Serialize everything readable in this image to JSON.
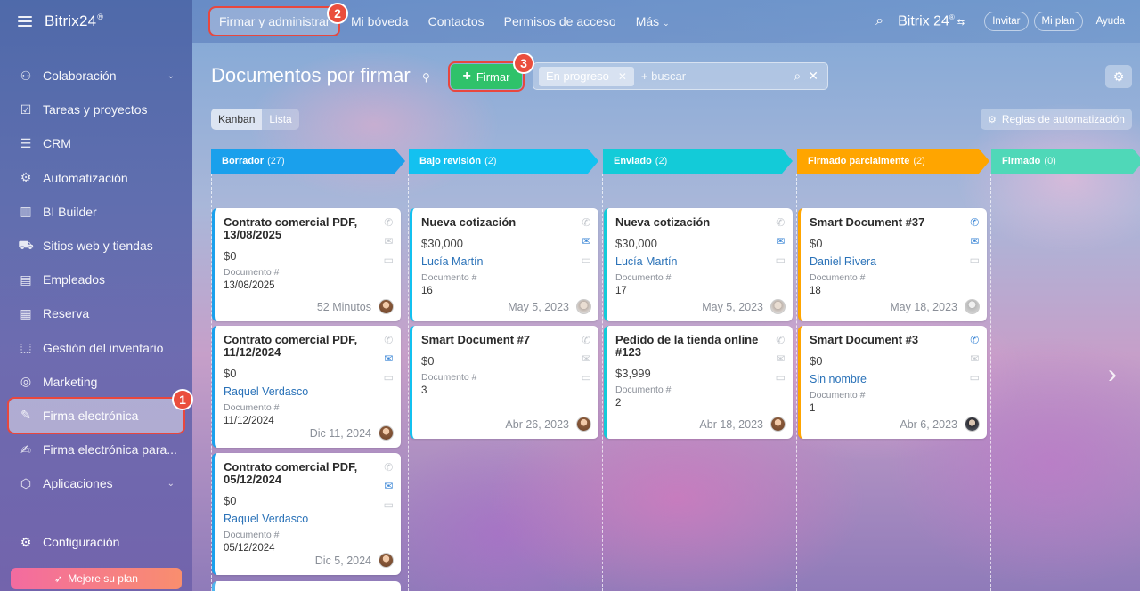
{
  "sidebar": {
    "brand": "Bitrix24",
    "brand_mark": "®",
    "items": [
      {
        "label": "Colaboración",
        "icon": "collaboration-icon",
        "glyph": "⚇",
        "chevron": true
      },
      {
        "label": "Tareas y proyectos",
        "icon": "tasks-icon",
        "glyph": "☑",
        "chevron": false
      },
      {
        "label": "CRM",
        "icon": "crm-icon",
        "glyph": "☰",
        "chevron": false
      },
      {
        "label": "Automatización",
        "icon": "automation-icon",
        "glyph": "⚙",
        "chevron": false
      },
      {
        "label": "BI Builder",
        "icon": "bi-builder-icon",
        "glyph": "▥",
        "chevron": false
      },
      {
        "label": "Sitios web y tiendas",
        "icon": "cart-icon",
        "glyph": "⛟",
        "chevron": false
      },
      {
        "label": "Empleados",
        "icon": "employees-icon",
        "glyph": "▤",
        "chevron": false
      },
      {
        "label": "Reserva",
        "icon": "calendar-icon",
        "glyph": "▦",
        "chevron": false
      },
      {
        "label": "Gestión del inventario",
        "icon": "inventory-icon",
        "glyph": "⬚",
        "chevron": false
      },
      {
        "label": "Marketing",
        "icon": "marketing-icon",
        "glyph": "◎",
        "chevron": false
      },
      {
        "label": "Firma electrónica",
        "icon": "signature-icon",
        "glyph": "✎",
        "chevron": false,
        "active": true
      },
      {
        "label": "Firma electrónica para...",
        "icon": "document-signature-icon",
        "glyph": "✍",
        "chevron": false
      },
      {
        "label": "Aplicaciones",
        "icon": "apps-icon",
        "glyph": "⬡",
        "chevron": true
      }
    ],
    "config_label": "Configuración",
    "upgrade_label": "Mejore su plan"
  },
  "topbar": {
    "tabs": [
      {
        "label": "Firmar y administrar",
        "active": true
      },
      {
        "label": "Mi bóveda"
      },
      {
        "label": "Contactos"
      },
      {
        "label": "Permisos de acceso"
      },
      {
        "label": "Más",
        "chevron": true
      }
    ],
    "brand": "Bitrix 24",
    "brand_mark": "®",
    "buttons": {
      "invite": "Invitar",
      "plan": "Mi plan",
      "help": "Ayuda"
    }
  },
  "badges": {
    "b1": "1",
    "b2": "2",
    "b3": "3"
  },
  "header": {
    "title": "Documentos por firmar",
    "sign_button": "Firmar",
    "filter_chip": "En progreso",
    "search_placeholder": "+ buscar",
    "view_kanban": "Kanban",
    "view_list": "Lista",
    "automation_rules": "Reglas de automatización"
  },
  "columns": [
    {
      "name": "Borrador",
      "count": "(27)",
      "color": "#1aa0ec"
    },
    {
      "name": "Bajo revisión",
      "count": "(2)",
      "color": "#13c1f0"
    },
    {
      "name": "Enviado",
      "count": "(2)",
      "color": "#13cbd8"
    },
    {
      "name": "Firmado parcialmente",
      "count": "(2)",
      "color": "#ffa500"
    },
    {
      "name": "Firmado",
      "count": "(0)",
      "color": "#4fd8b8"
    }
  ],
  "cards": [
    {
      "col": 0,
      "title": "Contrato comercial PDF, 13/08/2025",
      "amount": "$0",
      "person": "",
      "doc_label": "Documento #",
      "doc_value": "13/08/2025",
      "date": "52 Minutos",
      "avatar": "",
      "mail_on": false,
      "phone_on": false
    },
    {
      "col": 0,
      "title": "Contrato comercial PDF, 11/12/2024",
      "amount": "$0",
      "person": "Raquel Verdasco",
      "doc_label": "Documento #",
      "doc_value": "11/12/2024",
      "date": "Dic 11, 2024",
      "avatar": "",
      "mail_on": true,
      "phone_on": false
    },
    {
      "col": 0,
      "title": "Contrato comercial PDF, 05/12/2024",
      "amount": "$0",
      "person": "Raquel Verdasco",
      "doc_label": "Documento #",
      "doc_value": "05/12/2024",
      "date": "Dic 5, 2024",
      "avatar": "",
      "mail_on": true,
      "phone_on": false
    },
    {
      "col": 1,
      "title": "Nueva cotización",
      "amount": "$30,000",
      "person": "Lucía Martín",
      "doc_label": "Documento #",
      "doc_value": "16",
      "date": "May 5, 2023",
      "avatar": "light",
      "mail_on": true,
      "phone_on": false
    },
    {
      "col": 1,
      "title": "Smart Document #7",
      "amount": "$0",
      "person": "",
      "doc_label": "Documento #",
      "doc_value": "3",
      "date": "Abr 26, 2023",
      "avatar": "",
      "mail_on": false,
      "phone_on": false
    },
    {
      "col": 2,
      "title": "Nueva cotización",
      "amount": "$30,000",
      "person": "Lucía Martín",
      "doc_label": "Documento #",
      "doc_value": "17",
      "date": "May 5, 2023",
      "avatar": "light",
      "mail_on": true,
      "phone_on": false
    },
    {
      "col": 2,
      "title": "Pedido de la tienda online #123",
      "amount": "$3,999",
      "person": "",
      "doc_label": "Documento #",
      "doc_value": "2",
      "date": "Abr 18, 2023",
      "avatar": "",
      "mail_on": false,
      "phone_on": false
    },
    {
      "col": 3,
      "title": "Smart Document #37",
      "amount": "$0",
      "person": "Daniel Rivera",
      "doc_label": "Documento #",
      "doc_value": "18",
      "date": "May 18, 2023",
      "avatar": "gray",
      "mail_on": true,
      "phone_on": true
    },
    {
      "col": 3,
      "title": "Smart Document #3",
      "amount": "$0",
      "person": "Sin nombre",
      "doc_label": "Documento #",
      "doc_value": "1",
      "date": "Abr 6, 2023",
      "avatar": "dark",
      "mail_on": false,
      "phone_on": true
    }
  ]
}
